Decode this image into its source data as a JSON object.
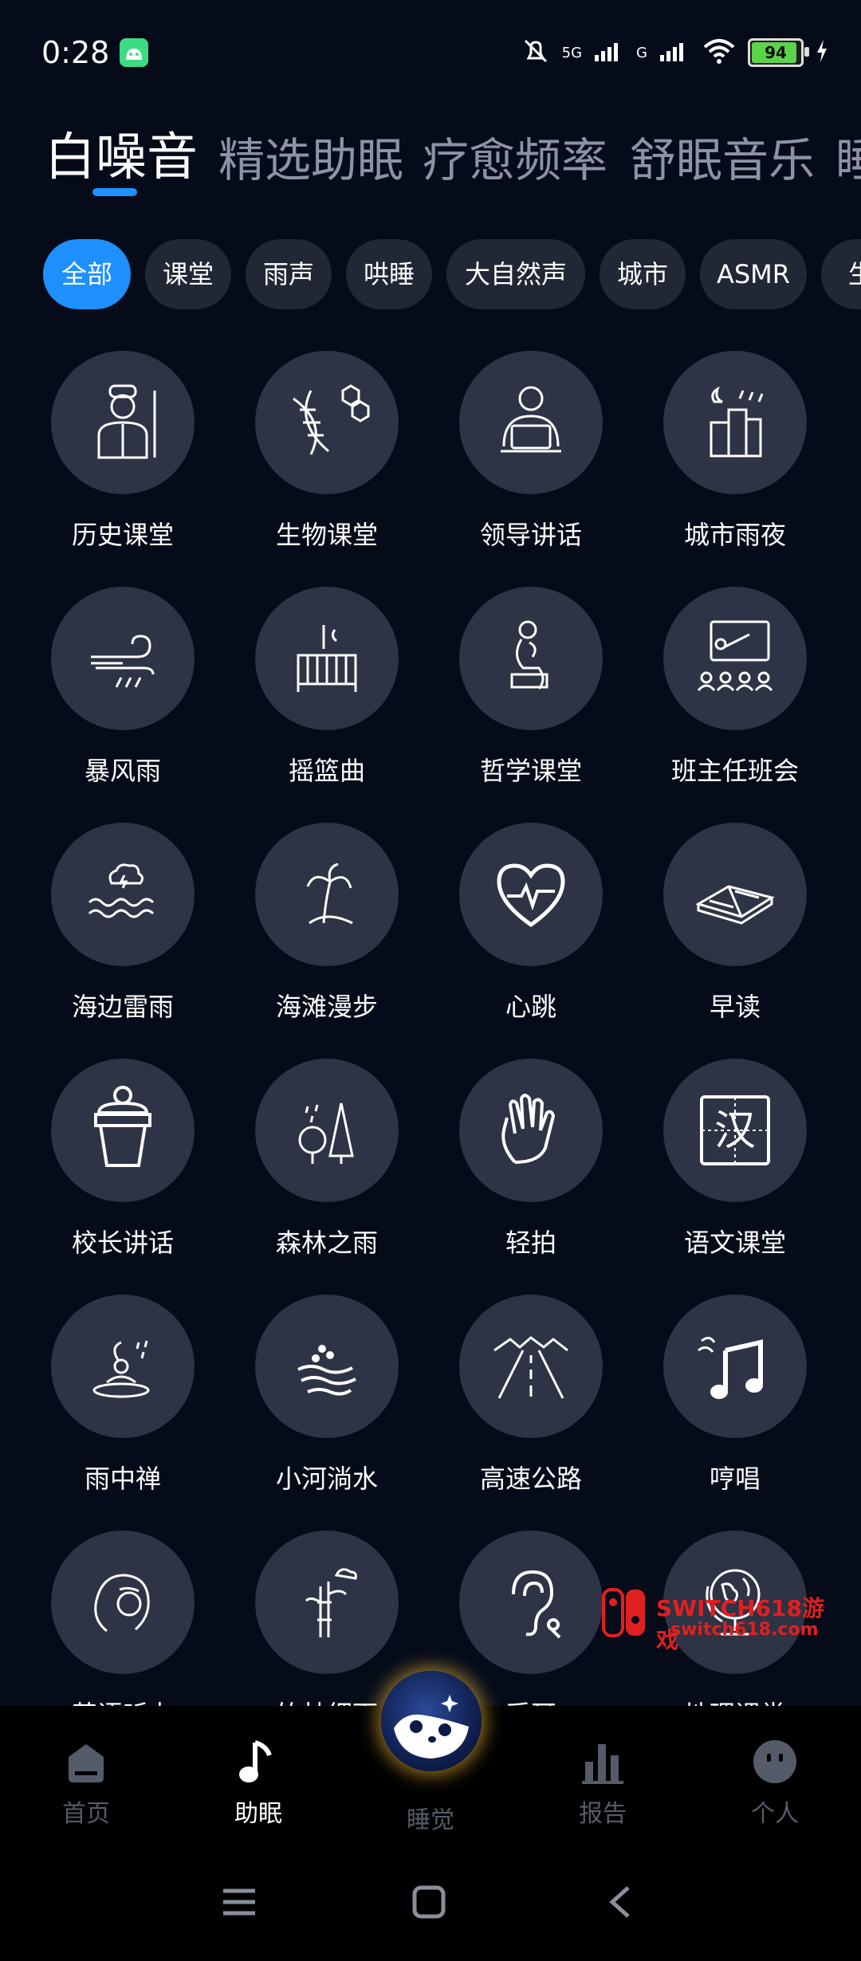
{
  "status_bar": {
    "time": "0:28",
    "network": "5G",
    "network2": "G",
    "battery": "94"
  },
  "tabs": [
    {
      "label": "白噪音"
    },
    {
      "label": "精选助眠"
    },
    {
      "label": "疗愈频率"
    },
    {
      "label": "舒眠音乐"
    },
    {
      "label": "睡"
    }
  ],
  "chips": [
    {
      "label": "全部"
    },
    {
      "label": "课堂"
    },
    {
      "label": "雨声"
    },
    {
      "label": "哄睡"
    },
    {
      "label": "大自然声"
    },
    {
      "label": "城市"
    },
    {
      "label": "ASMR"
    },
    {
      "label": "生"
    }
  ],
  "sounds": [
    {
      "label": "历史课堂",
      "icon": "historian-icon"
    },
    {
      "label": "生物课堂",
      "icon": "dna-icon"
    },
    {
      "label": "领导讲话",
      "icon": "leader-laptop-icon"
    },
    {
      "label": "城市雨夜",
      "icon": "city-rain-icon"
    },
    {
      "label": "暴风雨",
      "icon": "storm-wind-icon"
    },
    {
      "label": "摇篮曲",
      "icon": "crib-icon"
    },
    {
      "label": "哲学课堂",
      "icon": "thinker-icon"
    },
    {
      "label": "班主任班会",
      "icon": "classroom-icon"
    },
    {
      "label": "海边雷雨",
      "icon": "sea-thunder-icon"
    },
    {
      "label": "海滩漫步",
      "icon": "beach-icon"
    },
    {
      "label": "心跳",
      "icon": "heartbeat-icon"
    },
    {
      "label": "早读",
      "icon": "book-icon"
    },
    {
      "label": "校长讲话",
      "icon": "podium-icon"
    },
    {
      "label": "森林之雨",
      "icon": "forest-rain-icon"
    },
    {
      "label": "轻拍",
      "icon": "hand-icon"
    },
    {
      "label": "语文课堂",
      "icon": "chinese-character-icon"
    },
    {
      "label": "雨中禅",
      "icon": "zen-icon"
    },
    {
      "label": "小河淌水",
      "icon": "river-icon"
    },
    {
      "label": "高速公路",
      "icon": "highway-icon"
    },
    {
      "label": "哼唱",
      "icon": "music-note-icon"
    },
    {
      "label": "英语听力",
      "icon": "headphones-icon"
    },
    {
      "label": "竹林细雨",
      "icon": "bamboo-icon"
    },
    {
      "label": "采耳",
      "icon": "ear-icon"
    },
    {
      "label": "地理课堂",
      "icon": "globe-icon"
    }
  ],
  "watermark": {
    "text": "SWITCH618游戏",
    "sub": "switch618.com"
  },
  "bottom_nav": [
    {
      "label": "首页",
      "icon": "home-icon"
    },
    {
      "label": "助眠",
      "icon": "music-icon"
    },
    {
      "label": "睡觉",
      "icon": "panda-moon-icon"
    },
    {
      "label": "报告",
      "icon": "bar-chart-icon"
    },
    {
      "label": "个人",
      "icon": "profile-icon"
    }
  ],
  "colors": {
    "accent": "#1e90ff",
    "background": "#050b19",
    "tile": "#2e3345",
    "chip": "#222735",
    "glow": "#ffc43c"
  }
}
